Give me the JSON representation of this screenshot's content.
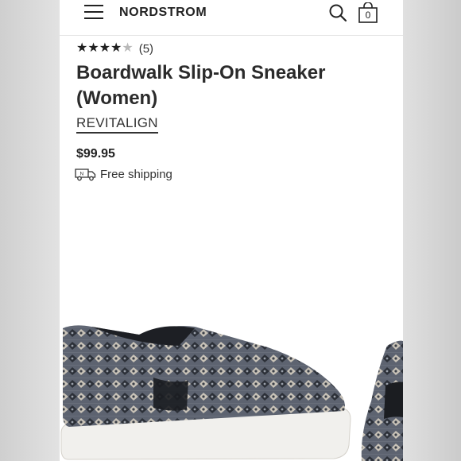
{
  "header": {
    "logo": "NORDSTROM",
    "bag_count": "0"
  },
  "product": {
    "rating_stars": 4,
    "rating_max": 5,
    "review_count": "(5)",
    "title": "Boardwalk Slip-On Sneaker (Women)",
    "brand": "REVITALIGN",
    "price": "$99.95",
    "shipping": "Free shipping"
  },
  "icons": {
    "menu": "hamburger-menu-icon",
    "search": "search-icon",
    "bag": "shopping-bag-icon",
    "truck": "delivery-truck-icon"
  },
  "colors": {
    "text_dark": "#222222",
    "star_filled": "#1f1f1f",
    "star_empty": "#b9b9b9"
  }
}
